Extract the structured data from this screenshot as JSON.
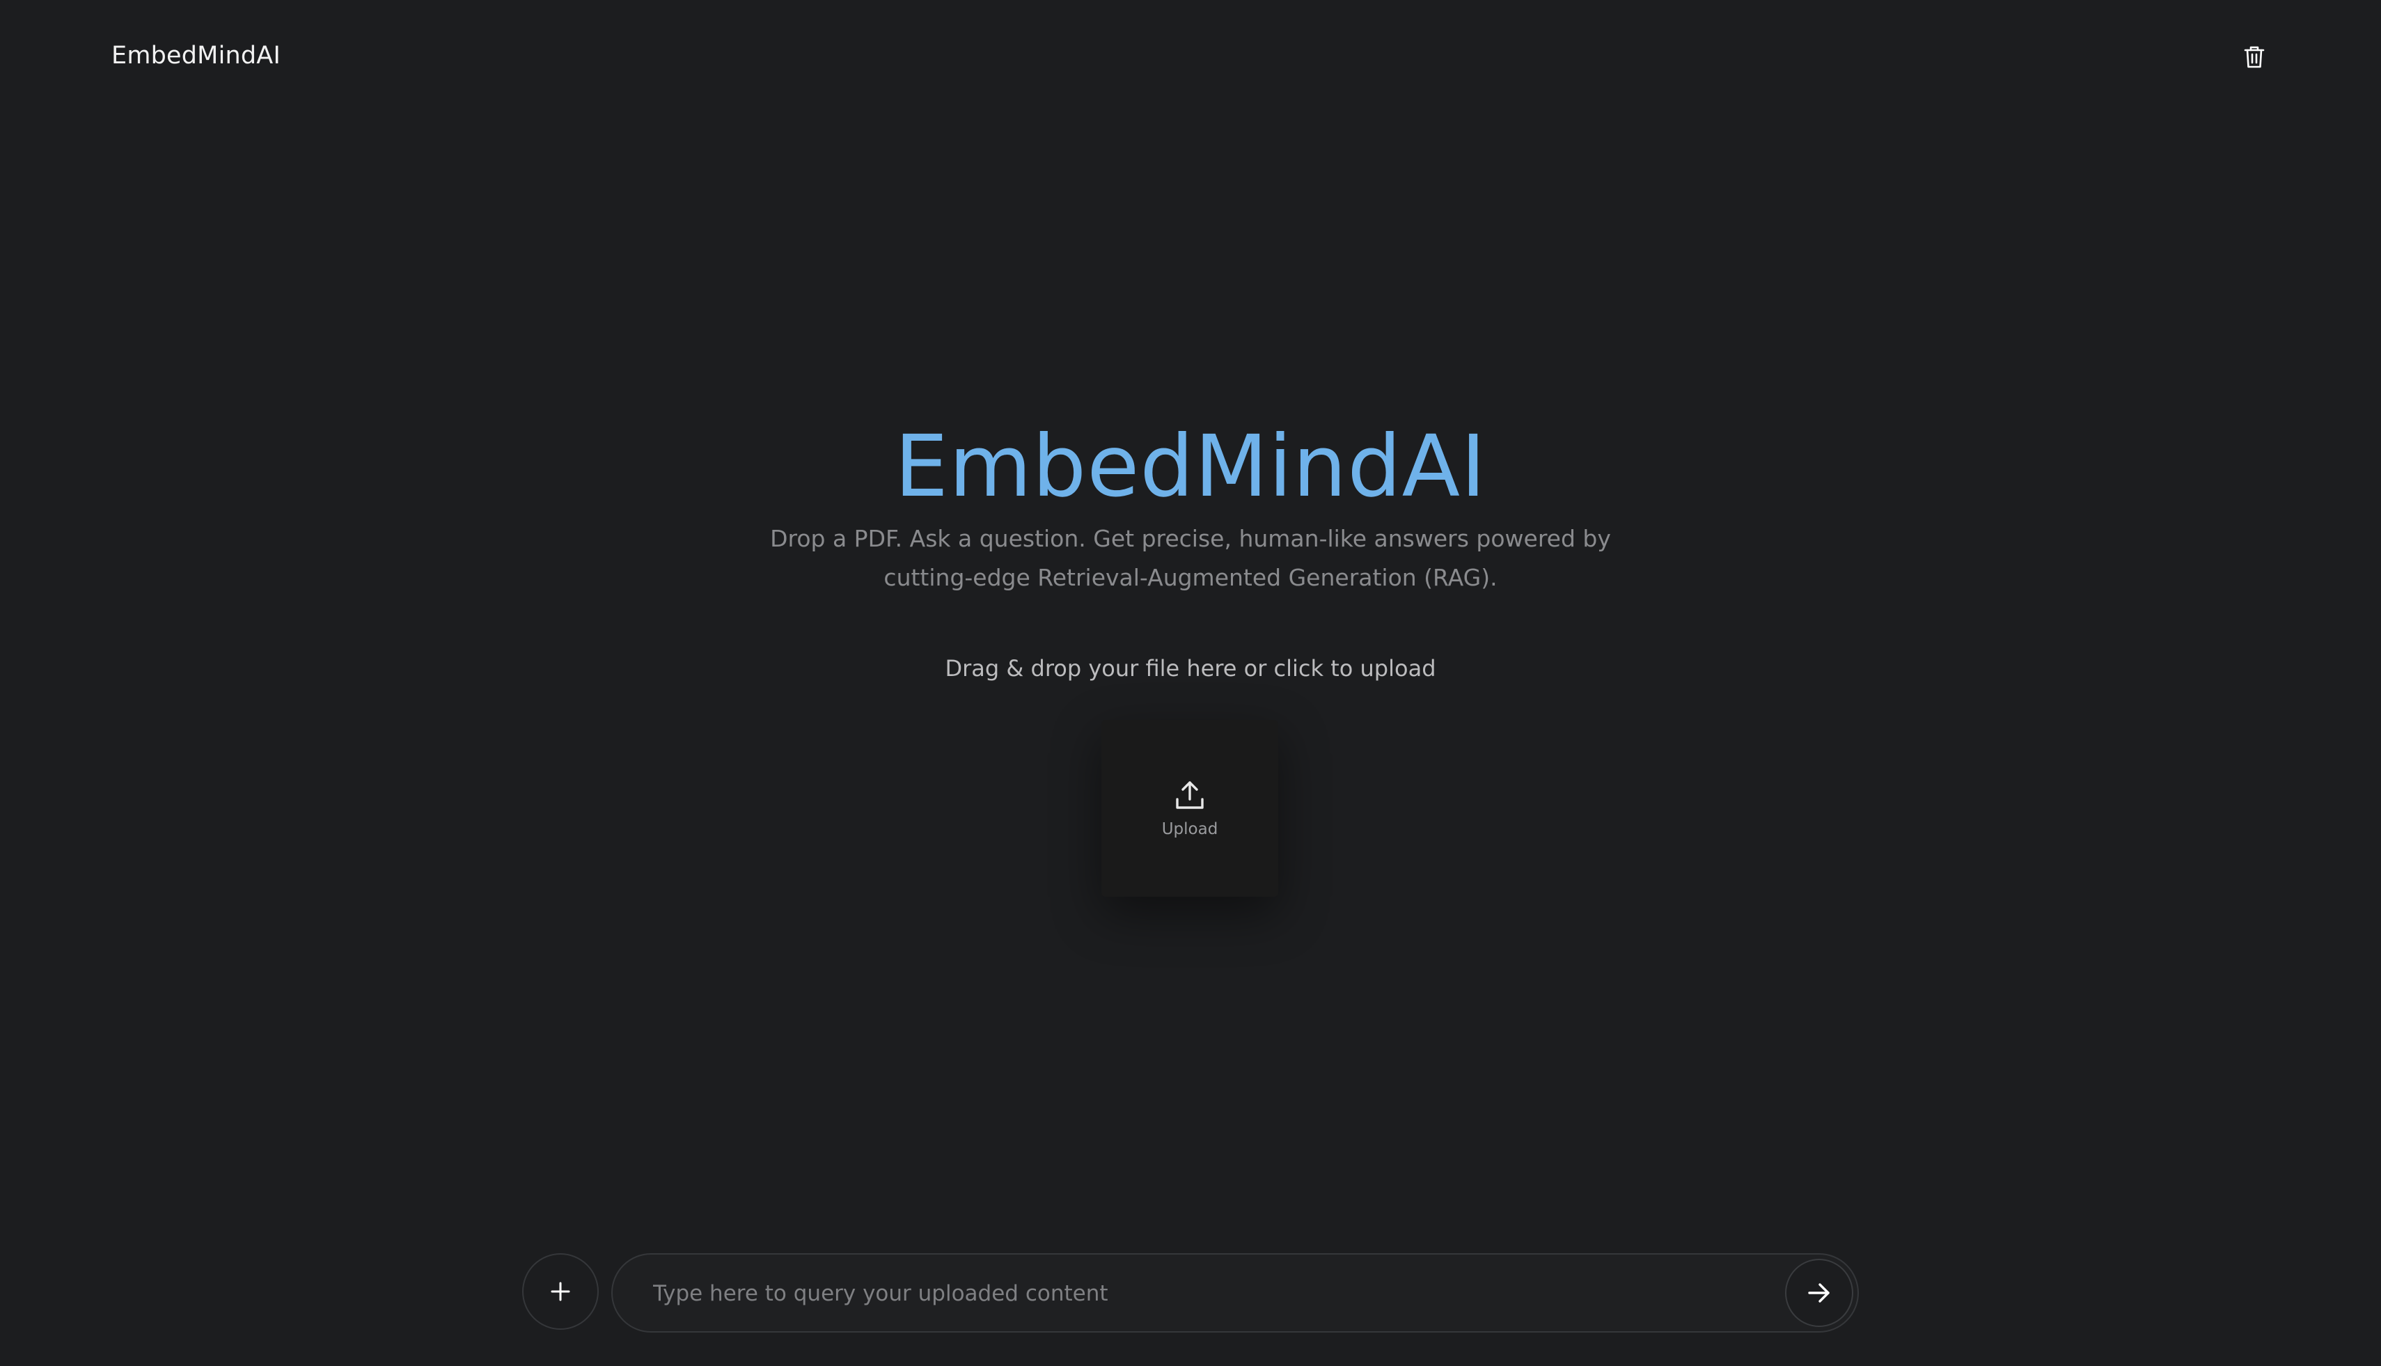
{
  "header": {
    "brand": "EmbedMindAI",
    "clear_icon": "trash-icon"
  },
  "hero": {
    "title": "EmbedMindAI",
    "subtitle": "Drop a PDF. Ask a question. Get precise, human-like answers powered by cutting-edge Retrieval-Augmented Generation (RAG)."
  },
  "upload": {
    "prompt": "Drag & drop your file here or click to upload",
    "button_label": "Upload",
    "icon": "upload-icon"
  },
  "query": {
    "placeholder": "Type here to query your uploaded content",
    "value": "",
    "add_icon": "plus-icon",
    "send_icon": "arrow-right-icon"
  },
  "colors": {
    "background": "#1c1d1f",
    "accent": "#6fb2ea",
    "muted_text": "#8a8b8e"
  }
}
